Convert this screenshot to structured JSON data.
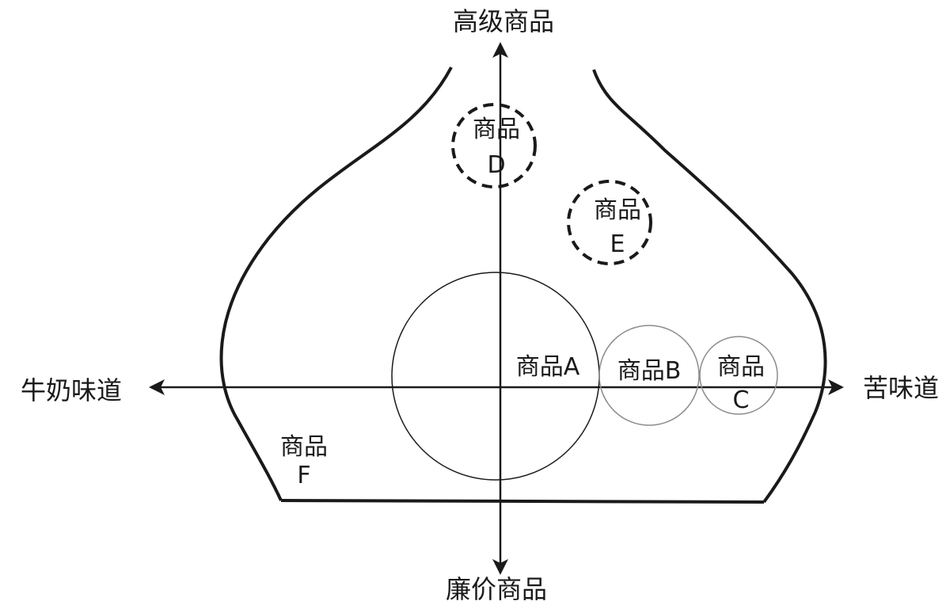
{
  "axes": {
    "top": "高级商品",
    "bottom": "廉价商品",
    "left": "牛奶味道",
    "right": "苦味道"
  },
  "products": [
    {
      "id": "A",
      "line1": "商品A",
      "line2": "",
      "style": "solid-thin"
    },
    {
      "id": "B",
      "line1": "商品B",
      "line2": "",
      "style": "solid-gray"
    },
    {
      "id": "C",
      "line1": "商品",
      "line2": "C",
      "style": "solid-gray"
    },
    {
      "id": "D",
      "line1": "商品",
      "line2": "D",
      "style": "dashed"
    },
    {
      "id": "E",
      "line1": "商品",
      "line2": "E",
      "style": "dashed"
    },
    {
      "id": "F",
      "line1": "商品",
      "line2": "F",
      "style": "none"
    }
  ],
  "colors": {
    "stroke": "#1a1a1a",
    "gray_stroke": "#8c8c8c",
    "background": "#ffffff"
  }
}
